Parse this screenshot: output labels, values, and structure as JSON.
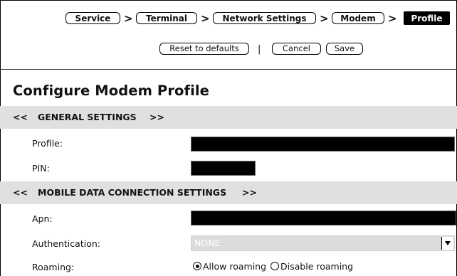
{
  "breadcrumb": {
    "items": [
      "Service",
      "Terminal",
      "Network Settings",
      "Modem",
      "Profile"
    ],
    "separator": ">"
  },
  "actions": {
    "reset_label": "Reset to defaults",
    "divider": "|",
    "cancel_label": "Cancel",
    "save_label": "Save"
  },
  "page": {
    "title": "Configure Modem Profile"
  },
  "general": {
    "prev": "<<",
    "heading": "GENERAL SETTINGS",
    "next": ">>",
    "profile_label": "Profile:",
    "pin_label": "PIN:"
  },
  "mobile": {
    "prev": "<<",
    "heading": "MOBILE DATA CONNECTION SETTINGS",
    "next": ">>",
    "apn_label": "Apn:",
    "auth_label": "Authentication:",
    "auth_value": "NONE",
    "roaming_label": "Roaming:",
    "roaming_options": [
      "Allow roaming",
      "Disable roaming"
    ],
    "roaming_selected": "Allow roaming"
  }
}
